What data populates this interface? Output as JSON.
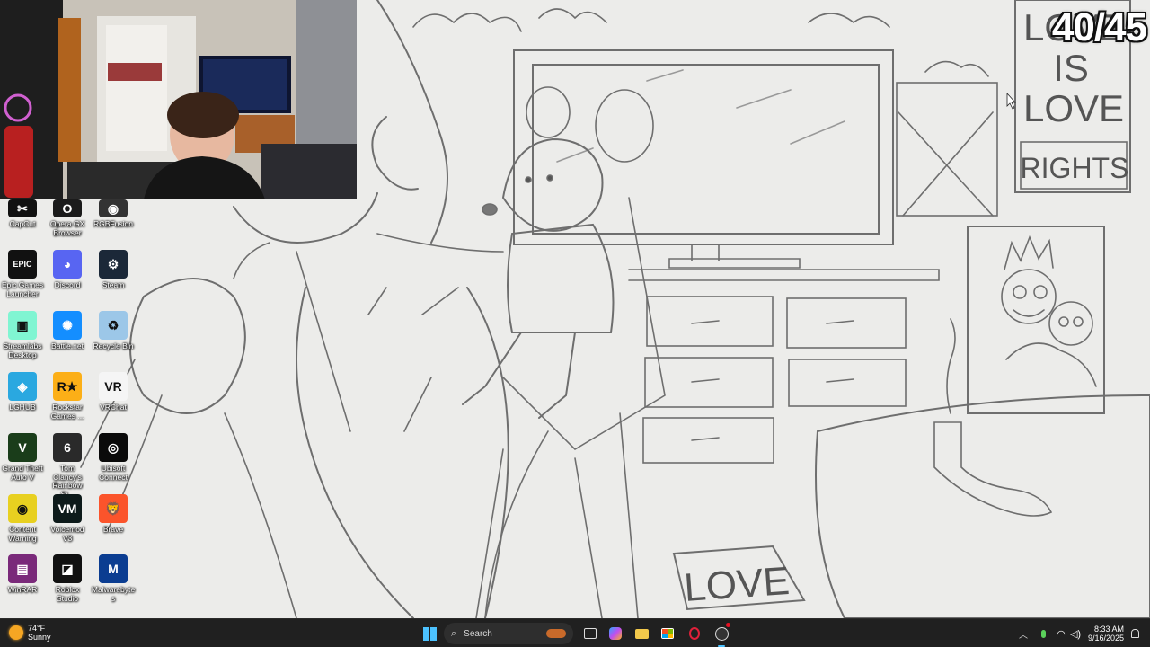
{
  "overlay": {
    "counter": "40/45"
  },
  "drawing": {
    "poster_text": [
      "LOVE",
      "IS",
      "LOVE",
      "RIGHTS"
    ],
    "sign_text": "LOVE"
  },
  "desktop_icons": [
    {
      "label": "CapCut",
      "icon": "capcut-icon",
      "color": "#111111",
      "glyph": "✂"
    },
    {
      "label": "Opera GX Browser",
      "icon": "opera-gx-icon",
      "color": "#1b1b1b",
      "glyph": "O"
    },
    {
      "label": "RGBFusion",
      "icon": "rgb-fusion-icon",
      "color": "#333333",
      "glyph": "◉"
    },
    {
      "label": "Epic Games Launcher",
      "icon": "epic-games-icon",
      "color": "#111111",
      "glyph": "EPIC"
    },
    {
      "label": "Discord",
      "icon": "discord-icon",
      "color": "#5865F2",
      "glyph": "◕"
    },
    {
      "label": "Steam",
      "icon": "steam-icon",
      "color": "#1b2838",
      "glyph": "⚙"
    },
    {
      "label": "Streamlabs Desktop",
      "icon": "streamlabs-icon",
      "color": "#80f5d2",
      "glyph": "▣"
    },
    {
      "label": "Battle.net",
      "icon": "battlenet-icon",
      "color": "#148eff",
      "glyph": "✺"
    },
    {
      "label": "Recycle Bin",
      "icon": "recycle-bin-icon",
      "color": "#9cc7e8",
      "glyph": "♻"
    },
    {
      "label": "LGHUB",
      "icon": "lghub-icon",
      "color": "#2aa8e0",
      "glyph": "◈"
    },
    {
      "label": "Rockstar Games ...",
      "icon": "rockstar-icon",
      "color": "#fcaf17",
      "glyph": "R★"
    },
    {
      "label": "VRChat",
      "icon": "vrchat-icon",
      "color": "#f5f5f5",
      "glyph": "VR"
    },
    {
      "label": "Grand Theft Auto V",
      "icon": "gta-v-icon",
      "color": "#1a3d1a",
      "glyph": "V"
    },
    {
      "label": "Tom Clancy's Rainbow Si...",
      "icon": "rainbow-six-icon",
      "color": "#2a2a2a",
      "glyph": "6"
    },
    {
      "label": "Ubisoft Connect",
      "icon": "ubisoft-icon",
      "color": "#0a0a0a",
      "glyph": "◎"
    },
    {
      "label": "Content Warning",
      "icon": "content-warning-icon",
      "color": "#e8d020",
      "glyph": "◉"
    },
    {
      "label": "Voicemod V3",
      "icon": "voicemod-icon",
      "color": "#0d1a1a",
      "glyph": "VM"
    },
    {
      "label": "Brave",
      "icon": "brave-icon",
      "color": "#fb542b",
      "glyph": "🦁"
    },
    {
      "label": "WinRAR",
      "icon": "winrar-icon",
      "color": "#7a2a7a",
      "glyph": "▤"
    },
    {
      "label": "Roblox Studio",
      "icon": "roblox-studio-icon",
      "color": "#111111",
      "glyph": "◪"
    },
    {
      "label": "Malwarebytes",
      "icon": "malwarebytes-icon",
      "color": "#0b3d91",
      "glyph": "M"
    }
  ],
  "taskbar": {
    "weather_temp": "74°F",
    "weather_desc": "Sunny",
    "search_placeholder": "Search",
    "time": "8:33 AM",
    "date": "9/16/2025"
  }
}
